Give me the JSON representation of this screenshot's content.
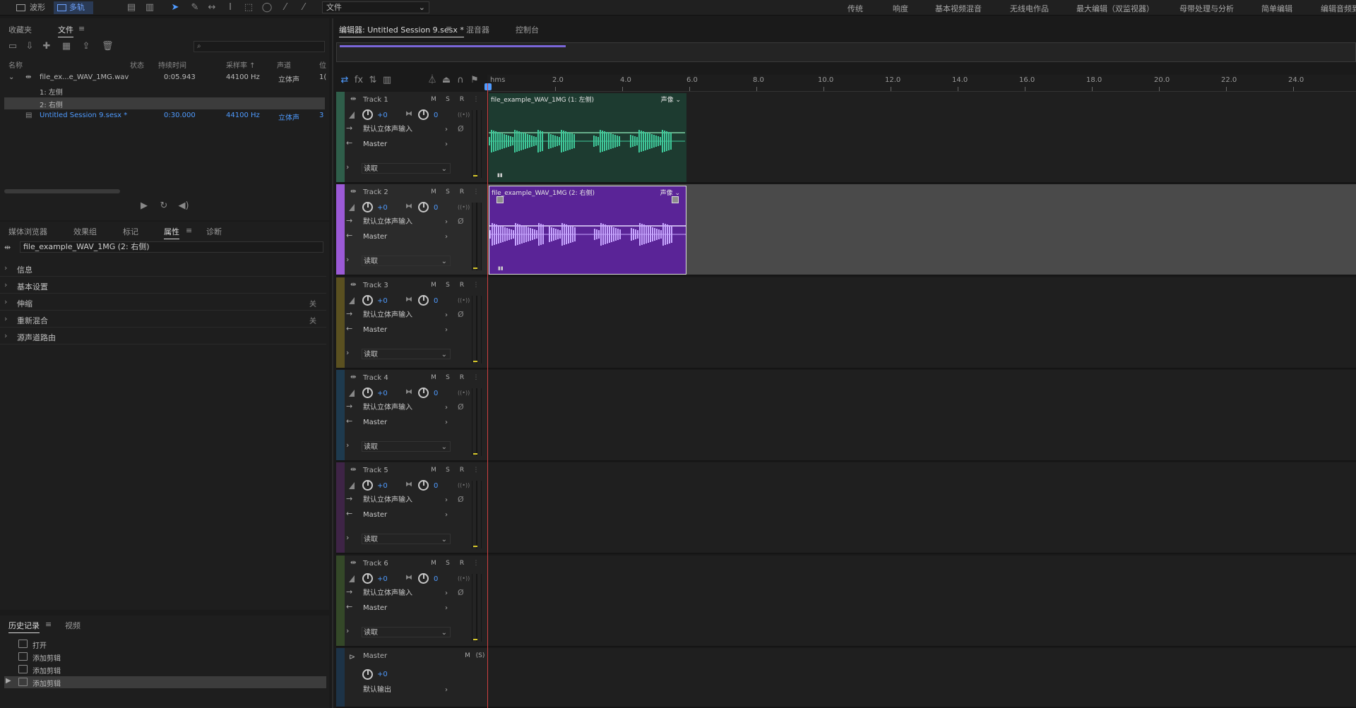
{
  "topbar": {
    "modes": [
      {
        "label": "波形"
      },
      {
        "label": "多轨"
      }
    ],
    "file_select": "文件",
    "workspaces": [
      "传统",
      "响度",
      "基本视频混音",
      "无线电作品",
      "最大编辑（双监视器）",
      "母带处理与分析",
      "简单编辑",
      "编辑音频到"
    ]
  },
  "files_panel": {
    "tabs": [
      "收藏夹",
      "文件"
    ],
    "columns": [
      "名称",
      "状态",
      "持续时间",
      "采样率 ↑",
      "声道",
      "位"
    ],
    "rows": [
      {
        "name": "file_ex...e_WAV_1MG.wav",
        "duration": "0:05.943",
        "rate": "44100 Hz",
        "channels": "立体声",
        "bits": "1("
      },
      {
        "name": "1: 左侧"
      },
      {
        "name": "2: 右侧"
      },
      {
        "name": "Untitled Session 9.sesx *",
        "duration": "0:30.000",
        "rate": "44100 Hz",
        "channels": "立体声",
        "bits": "3"
      }
    ]
  },
  "props_panel": {
    "tabs": [
      "媒体浏览器",
      "效果组",
      "标记",
      "属性",
      "诊断"
    ],
    "clip_name": "file_example_WAV_1MG (2: 右侧)",
    "rows": [
      {
        "label": "信息",
        "extra": ""
      },
      {
        "label": "基本设置",
        "extra": ""
      },
      {
        "label": "伸缩",
        "extra": "关"
      },
      {
        "label": "重新混合",
        "extra": "关"
      },
      {
        "label": "源声道路由",
        "extra": ""
      }
    ]
  },
  "history_panel": {
    "tabs": [
      "历史记录",
      "视频"
    ],
    "items": [
      "打开",
      "添加剪辑",
      "添加剪辑",
      "添加剪辑"
    ]
  },
  "editor": {
    "tabs": [
      "编辑器: Untitled Session 9.sesx *",
      "混音器",
      "控制台"
    ],
    "ruler": [
      "hms",
      "2.0",
      "4.0",
      "6.0",
      "8.0",
      "10.0",
      "12.0",
      "14.0",
      "16.0",
      "18.0",
      "20.0",
      "22.0",
      "24.0"
    ],
    "tracks": [
      {
        "name": "Track 1",
        "vol": "+0",
        "pan": "0",
        "input": "默认立体声输入",
        "output": "Master",
        "mode": "读取",
        "color": "#2f5e4a"
      },
      {
        "name": "Track 2",
        "vol": "+0",
        "pan": "0",
        "input": "默认立体声输入",
        "output": "Master",
        "mode": "读取",
        "color": "#9b5ad6"
      },
      {
        "name": "Track 3",
        "vol": "+0",
        "pan": "0",
        "input": "默认立体声输入",
        "output": "Master",
        "mode": "读取",
        "color": "#5a5020"
      },
      {
        "name": "Track 4",
        "vol": "+0",
        "pan": "0",
        "input": "默认立体声输入",
        "output": "Master",
        "mode": "读取",
        "color": "#1e3a4e"
      },
      {
        "name": "Track 5",
        "vol": "+0",
        "pan": "0",
        "input": "默认立体声输入",
        "output": "Master",
        "mode": "读取",
        "color": "#3e2446"
      },
      {
        "name": "Track 6",
        "vol": "+0",
        "pan": "0",
        "input": "默认立体声输入",
        "output": "Master",
        "mode": "读取",
        "color": "#344828"
      }
    ],
    "master": {
      "name": "Master",
      "vol": "+0",
      "output": "默认输出"
    },
    "clips": [
      {
        "title": "file_example_WAV_1MG (1: 左侧)",
        "tag": "声像"
      },
      {
        "title": "file_example_WAV_1MG (2: 右侧)",
        "tag": "声像"
      }
    ]
  },
  "buttons": {
    "m": "M",
    "s": "S",
    "r": "R"
  }
}
